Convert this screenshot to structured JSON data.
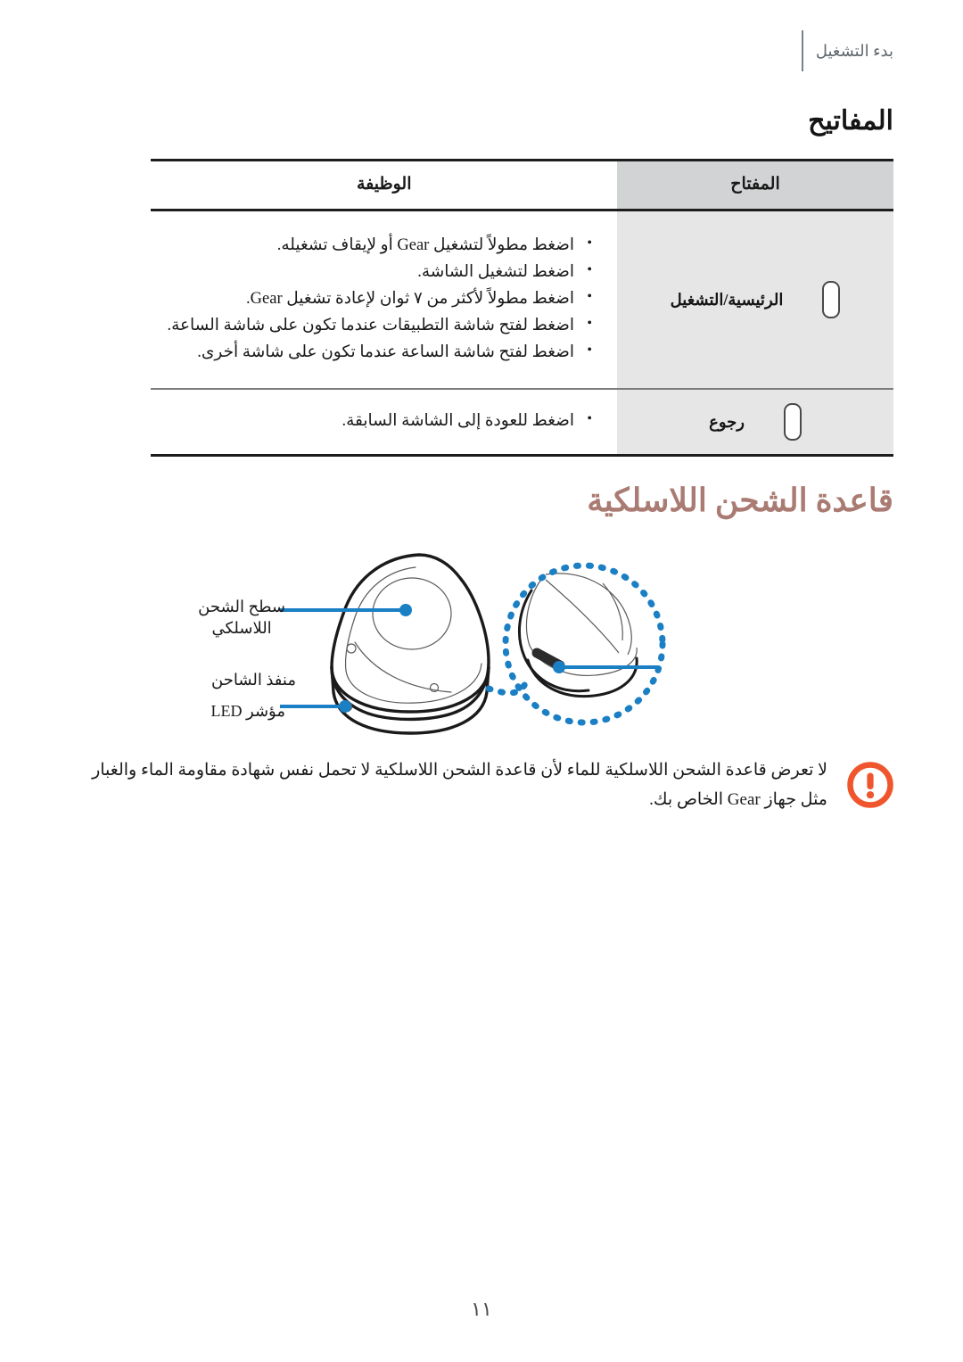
{
  "header": {
    "running_head": "بدء التشغيل"
  },
  "keys_section": {
    "title": "المفاتيح",
    "table": {
      "columns": [
        {
          "id": "key",
          "label": "المفتاح"
        },
        {
          "id": "function",
          "label": "الوظيفة"
        }
      ],
      "rows": [
        {
          "key_label": "الرئيسية/التشغيل",
          "key_icon": "pill-button-icon",
          "functions": [
            "اضغط مطولاً لتشغيل Gear أو لإيقاف تشغيله.",
            "اضغط لتشغيل الشاشة.",
            "اضغط مطولاً لأكثر من ٧ ثوان لإعادة تشغيل Gear.",
            "اضغط لفتح شاشة التطبيقات عندما تكون على شاشة الساعة.",
            "اضغط لفتح شاشة الساعة عندما تكون على شاشة أخرى."
          ]
        },
        {
          "key_label": "رجوع",
          "key_icon": "pill-button-icon",
          "functions": [
            "اضغط للعودة إلى الشاشة السابقة."
          ]
        }
      ]
    }
  },
  "wireless_charging_section": {
    "heading": "قاعدة الشحن اللاسلكية",
    "diagram_labels": {
      "charging_surface_line1": "سطح الشحن",
      "charging_surface_line2": "اللاسلكي",
      "led_indicator": "مؤشر LED",
      "charger_port": "منفذ الشاحن"
    }
  },
  "note": {
    "icon": "warning-exclamation-icon",
    "text": "لا تعرض قاعدة الشحن اللاسلكية للماء لأن قاعدة الشحن اللاسلكية لا تحمل نفس شهادة مقاومة الماء والغبار مثل جهاز Gear الخاص بك."
  },
  "footer": {
    "page_number": "١١"
  },
  "colors": {
    "heading_accent": "#a97b72",
    "diagram_accent": "#1b7fc4",
    "warning": "#f0562d",
    "table_header_fill": "#d2d3d4",
    "table_key_fill": "#e6e6e6"
  }
}
